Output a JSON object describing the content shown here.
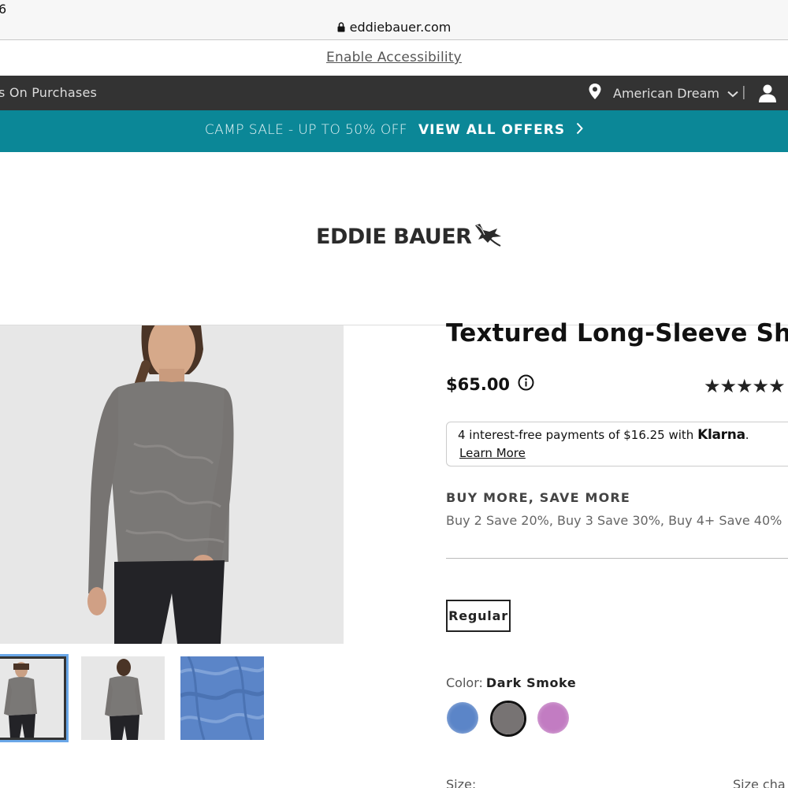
{
  "browser": {
    "edge_text": "6",
    "url": "eddiebauer.com"
  },
  "accessibility": {
    "link": "Enable Accessibility"
  },
  "store_bar": {
    "left_text": "s On Purchases",
    "store_name": "American Dream",
    "divider": "|"
  },
  "promo": {
    "sale_text": "CAMP SALE - UP TO 50% OFF",
    "cta": "VIEW ALL OFFERS"
  },
  "brand": {
    "logo_text": "EDDIE BAUER"
  },
  "product": {
    "title": "Textured Long-Sleeve Shirt",
    "price": "$65.00",
    "rating_stars": "★★★★★",
    "rating_value": 5,
    "klarna": {
      "text": "4 interest-free payments of $16.25 with",
      "brand": "Klarna",
      "suffix": ".",
      "learn_more": "Learn More"
    },
    "bulk": {
      "title": "BUY MORE, SAVE MORE",
      "text": "Buy 2 Save 20%, Buy 3 Save 30%, Buy 4+ Save 40%"
    },
    "fit": "Regular",
    "color_label": "Color:",
    "color_value": "Dark Smoke",
    "swatches": [
      {
        "name": "blue",
        "color": "#5b85c8"
      },
      {
        "name": "dark-smoke",
        "color": "#777373"
      },
      {
        "name": "purple",
        "color": "#c27cc2"
      }
    ],
    "size_label": "Size:",
    "size_chart": "Size cha"
  },
  "colors": {
    "store_bar": "#333333",
    "promo_bar": "#0b8797",
    "thumb_selected": "#6aa7e8"
  }
}
